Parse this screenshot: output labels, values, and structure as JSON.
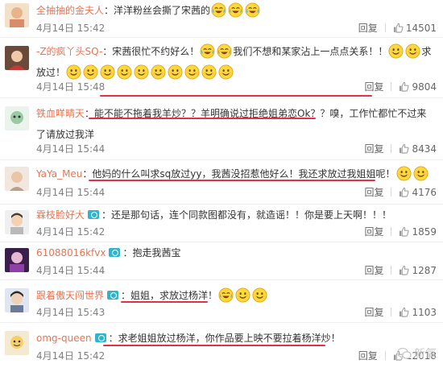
{
  "comments": [
    {
      "name": "全抽抽的金夫人",
      "verified": false,
      "text": "洋洋粉丝会撕了宋茜的",
      "emoji_after": 3,
      "emoji_type": "laugh",
      "date": "4月14日",
      "time": "15:42",
      "reply": "回复",
      "likes": "14501"
    },
    {
      "name": "-Z的疯丫头SQ-",
      "verified": false,
      "text_parts": [
        "宋茜很忙不约好么！",
        "我们不想和某家沾上一点点关系！！",
        "求放过！"
      ],
      "emoji_groups": [
        2,
        2,
        10
      ],
      "emoji_type": "smile",
      "date": "4月14日",
      "time": "15:48",
      "reply": "回复",
      "likes": "9804"
    },
    {
      "name": "铁血咩晴天",
      "verified": false,
      "text": "能不能不拖着我羊炒？？羊明确说过拒绝姐弟恋Ok？？嗅，工作忙都忙不过来了请放过我洋",
      "date": "4月14日",
      "time": "15:44",
      "reply": "回复",
      "likes": "8434"
    },
    {
      "name": "YaYa_Meu",
      "verified": false,
      "text": "他妈的什么叫求sq放过yy，我茜没招惹他好么！我还求放过我姐姐呢！",
      "emoji_after": 2,
      "emoji_type": "smile",
      "date": "4月14日",
      "time": "15:44",
      "reply": "回复",
      "likes": "4176"
    },
    {
      "name": "霖枝脸好大",
      "verified": true,
      "text": "还是那句话，连个同款图都没有，就造谣！！你是要上天啊！！！",
      "date": "4月14日",
      "time": "15:42",
      "reply": "回复",
      "likes": "1859"
    },
    {
      "name": "61088016kfvx",
      "verified": true,
      "text": "抱走我茜宝",
      "date": "4月14日",
      "time": "15:44",
      "reply": "回复",
      "likes": "1287"
    },
    {
      "name": "跟着傲天闯世界",
      "verified": true,
      "text": "姐姐，求放过杨洋！",
      "emoji_after": 3,
      "emoji_type": "mix",
      "date": "4月14日",
      "time": "15:43",
      "reply": "回复",
      "likes": "1103"
    },
    {
      "name": "omg-queen",
      "verified": true,
      "text": "求老姐姐放过杨洋，你作品要上映不要拉着杨洋炒！",
      "date": "4月14日",
      "time": "15:42",
      "reply": "回复",
      "likes": "12018"
    }
  ],
  "watermark": "新氧",
  "colors": {
    "username": "#eb7350",
    "underline": "#e0304a",
    "verified_badge": "#2fb4cf",
    "meta": "#808080"
  }
}
